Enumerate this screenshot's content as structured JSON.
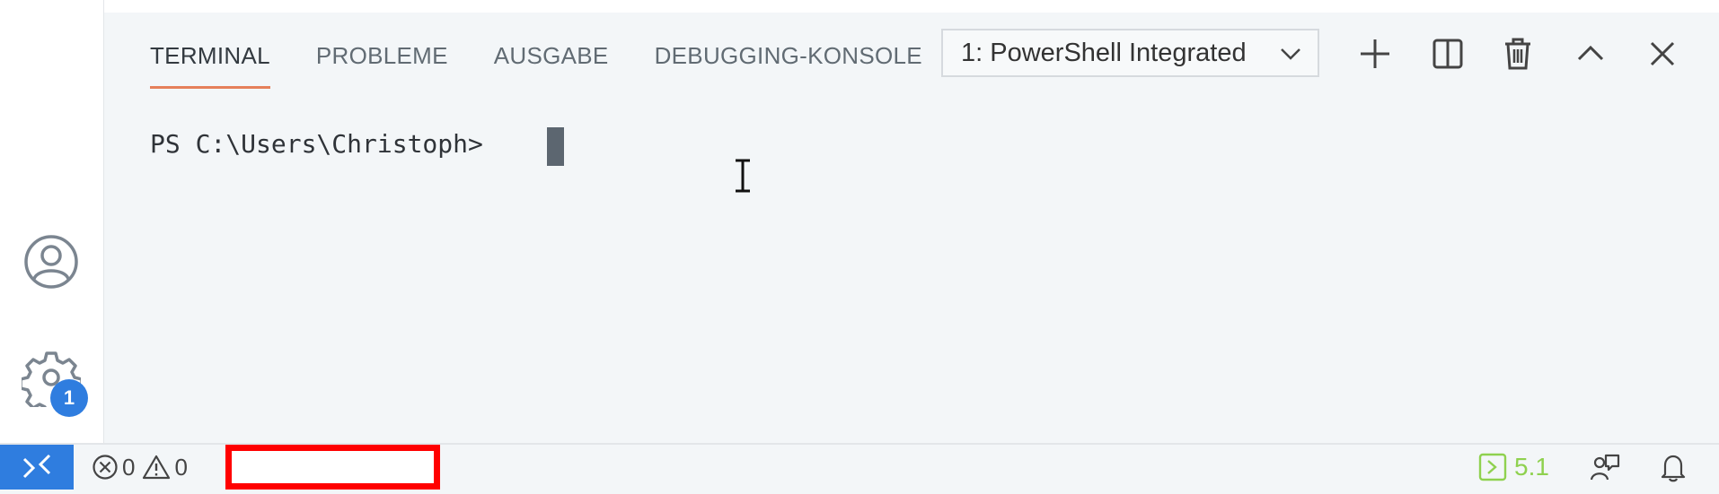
{
  "panel": {
    "tabs": [
      {
        "label": "TERMINAL",
        "active": true
      },
      {
        "label": "PROBLEME",
        "active": false
      },
      {
        "label": "AUSGABE",
        "active": false
      },
      {
        "label": "DEBUGGING-KONSOLE",
        "active": false
      }
    ],
    "terminal_select": {
      "value": "1: PowerShell Integrated"
    },
    "toolbar": [
      "plus-icon",
      "split-icon",
      "trash-icon",
      "chevron-up-icon",
      "close-icon"
    ]
  },
  "terminal": {
    "prompt": "PS C:\\Users\\Christoph>"
  },
  "activity_bar": {
    "manage_badge": "1"
  },
  "status_bar": {
    "errors": "0",
    "warnings": "0",
    "highlighted_item": "",
    "powershell_version": "5.1"
  },
  "colors": {
    "accent_blue": "#2f7ddf",
    "active_tab_underline": "#e5805a",
    "highlight_border": "#ff0000",
    "ps_version_green": "#8fd14f"
  }
}
